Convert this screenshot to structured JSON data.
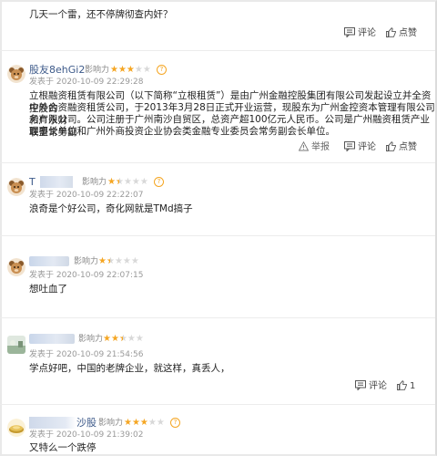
{
  "labels": {
    "influence": "影响力",
    "comment": "评论",
    "like": "点赞",
    "report": "举报"
  },
  "comments": [
    {
      "text": "几天一个雷，还不停牌彻查内奸？"
    },
    {
      "username": "股友8ehGi2",
      "rating": 3,
      "posted": "发表于 2020-10-09 22:29:28",
      "text": [
        "立根融资租赁有限公司（以下简称“立根租赁”）是由广州金融控股集团有限公司发起设立并全资控股的",
        "中外合资融资租赁公司，于2013年3月28日正式开业运营，现股东为广州金控资本管理有限公司和广永财",
        "务有限公司。公司注册于广州南沙自贸区，总资产超100亿元人民币。公司是广州融资租赁产业联盟常务副",
        "理事长单位和广州外商投资企业协会类金融专业委员会常务副会长单位。"
      ]
    },
    {
      "username": "T",
      "rating": 1.5,
      "posted": "发表于 2020-10-09 22:22:07",
      "text": "浪奇是个好公司，奇化网就是TMd搞子"
    },
    {
      "rating": 1.5,
      "posted": "发表于 2020-10-09 22:07:15",
      "text": "想吐血了"
    },
    {
      "rating": 2.5,
      "posted": "发表于 2020-10-09 21:54:56",
      "text": "学点好吧，中国的老牌企业，就这样，真丢人，",
      "likes": "1"
    },
    {
      "username": "沙股",
      "rating": 3,
      "posted": "发表于 2020-10-09 21:39:02",
      "text": "又特么一个跌停"
    }
  ]
}
